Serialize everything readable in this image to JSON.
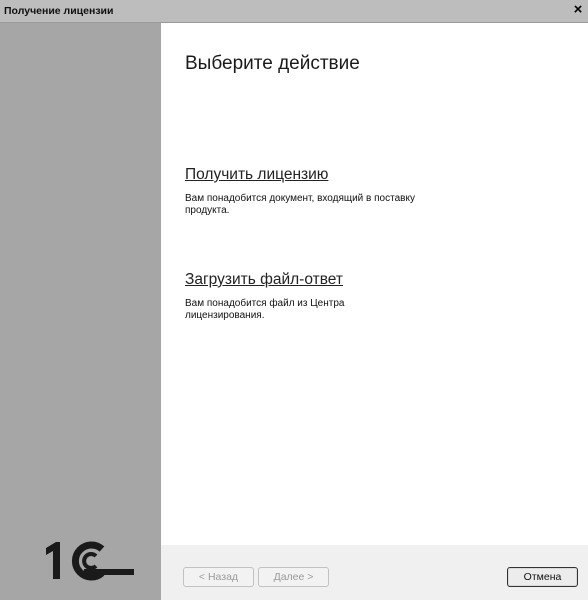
{
  "window": {
    "title": "Получение лицензии",
    "close_label": "×"
  },
  "main": {
    "heading": "Выберите действие",
    "actions": [
      {
        "label": "Получить лицензию",
        "description": "Вам понадобится документ, входящий в поставку продукта."
      },
      {
        "label": "Загрузить файл-ответ",
        "description": "Вам понадобится файл из Центра лицензирования."
      }
    ]
  },
  "footer": {
    "back_label": "< Назад",
    "next_label": "Далее >",
    "cancel_label": "Отмена"
  },
  "logo": {
    "text": "1С"
  },
  "colors": {
    "sidebar": "#a6a6a6",
    "titlebar": "#bdbdbd",
    "footer": "#f0f0f0"
  }
}
